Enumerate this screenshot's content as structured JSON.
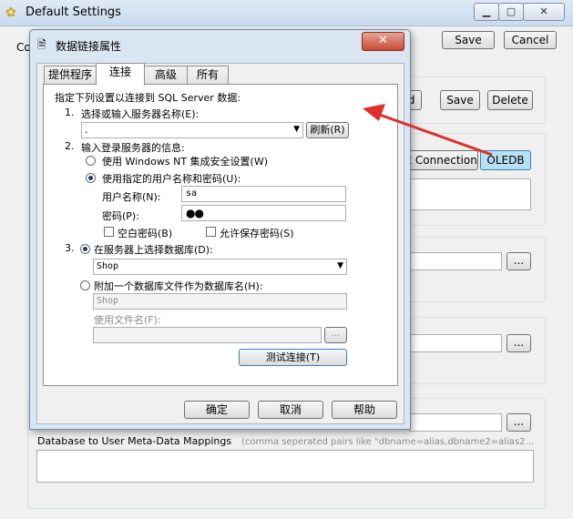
{
  "back_window": {
    "title": "Default Settings",
    "partial_label": "Co",
    "save_top": "Save",
    "cancel_top": "Cancel",
    "btn_partial": "d",
    "btn_save": "Save",
    "btn_delete": "Delete",
    "btn_test_connection": "st Connection",
    "btn_oledb": "OLEDB",
    "browse": "...",
    "meta_label": "Database to User Meta-Data Mappings",
    "meta_hint": "(comma seperated pairs like \"dbname=alias,dbname2=alias2..."
  },
  "dialog": {
    "title": "数据链接属性",
    "close": "✕",
    "tabs": [
      "提供程序",
      "连接",
      "高级",
      "所有"
    ],
    "intro": "指定下列设置以连接到 SQL Server 数据:",
    "step1_num": "1.",
    "step1_label": "选择或输入服务器名称(E):",
    "server_value": ".",
    "refresh": "刷新(R)",
    "step2_num": "2.",
    "step2_label": "输入登录服务器的信息:",
    "opt_nt": "使用 Windows NT 集成安全设置(W)",
    "opt_user": "使用指定的用户名称和密码(U):",
    "user_label": "用户名称(N):",
    "user_value": "sa",
    "pwd_label": "密码(P):",
    "pwd_value": "●●",
    "blank_pwd": "空白密码(B)",
    "allow_save": "允许保存密码(S)",
    "step3_num": "3.",
    "opt_select_db": "在服务器上选择数据库(D):",
    "db_value": "Shop",
    "opt_attach": "附加一个数据库文件作为数据库名(H):",
    "attach_value": "Shop",
    "file_label": "使用文件名(F):",
    "file_browse": "...",
    "test_button": "测试连接(T)",
    "ok": "确定",
    "cancel": "取消",
    "help": "帮助"
  },
  "colors": {
    "annotation_arrow": "#e0302a",
    "oledb_highlight": "#b7e0f5"
  }
}
